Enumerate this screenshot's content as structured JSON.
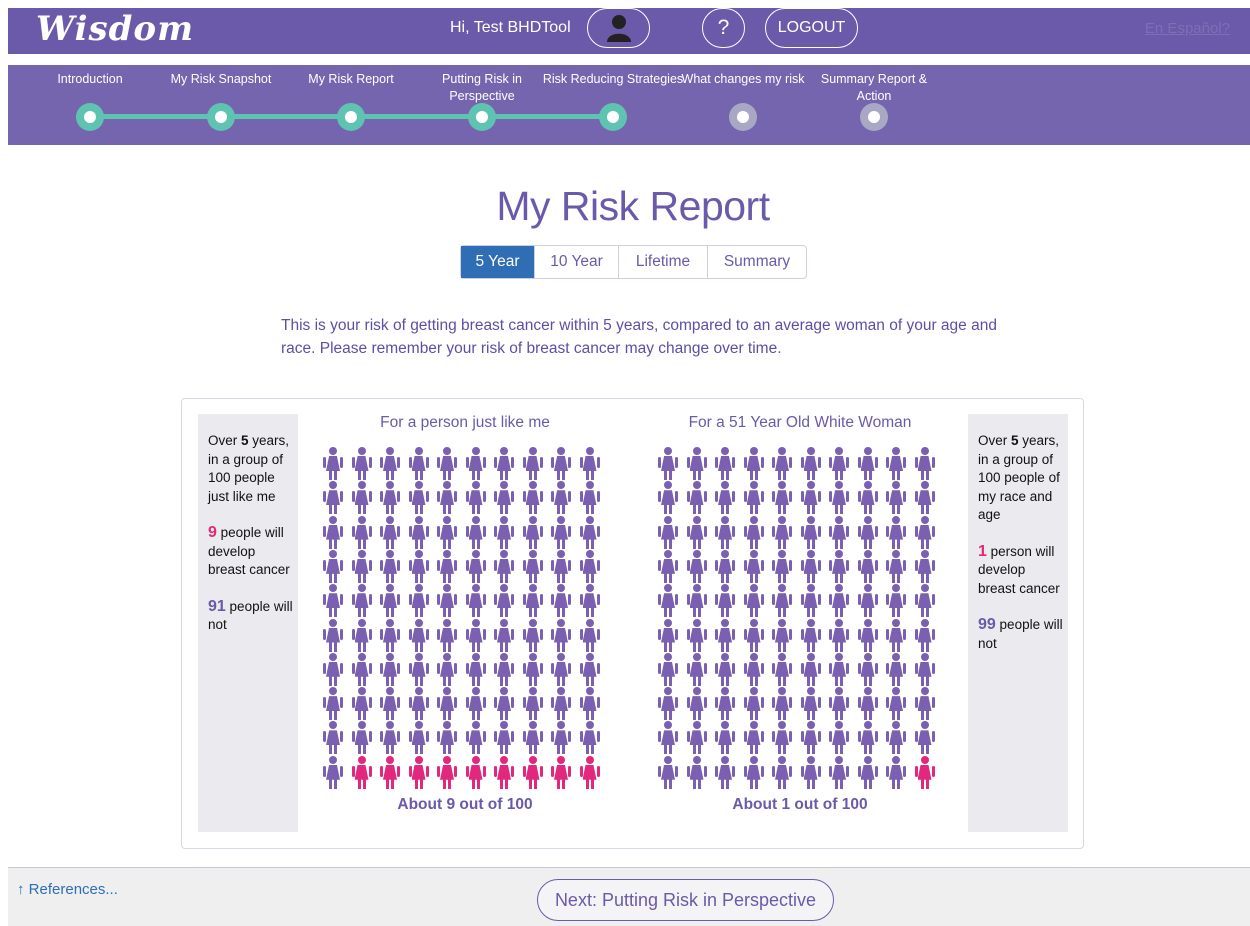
{
  "header": {
    "logo": "Wisdom",
    "greeting": "Hi, Test BHDTool",
    "help_label": "?",
    "logout_label": "LOGOUT",
    "espanol_label": "En Español?",
    "colors": {
      "header_bg": "#6a5aa9",
      "nav_bg": "#7565ae",
      "progress_done": "#5ec3b1",
      "progress_todo": "#a8a8c4"
    }
  },
  "progress": {
    "steps": [
      {
        "label": "Introduction",
        "status": "done"
      },
      {
        "label": "My Risk Snapshot",
        "status": "done"
      },
      {
        "label": "My Risk Report",
        "status": "done"
      },
      {
        "label": "Putting Risk in Perspective",
        "status": "done"
      },
      {
        "label": "Risk Reducing Strategies",
        "status": "done"
      },
      {
        "label": "What changes my risk",
        "status": "todo"
      },
      {
        "label": "Summary Report & Action",
        "status": "todo"
      }
    ]
  },
  "page": {
    "title": "My Risk Report",
    "tabs": [
      {
        "label": "5 Year",
        "active": true
      },
      {
        "label": "10 Year",
        "active": false
      },
      {
        "label": "Lifetime",
        "active": false
      },
      {
        "label": "Summary",
        "active": false
      }
    ],
    "intro": "This is your risk of getting breast cancer within 5 years, compared to an average woman of your age and race. Please remember your risk of breast cancer may change over time."
  },
  "risk_panel": {
    "left_side": {
      "line1_pre": "Over ",
      "line1_num": "5",
      "line1_post": " years, in a group of 100 people just like me",
      "affected_num": "9",
      "affected_text": " people will develop breast cancer",
      "unaffected_num": "91",
      "unaffected_text": " people will not"
    },
    "right_side": {
      "line1_pre": "Over ",
      "line1_num": "5",
      "line1_post": " years, in a group of 100 people of my race and age",
      "affected_num": "1",
      "affected_text": " person will develop breast cancer",
      "unaffected_num": "99",
      "unaffected_text": " people will not"
    },
    "charts": [
      {
        "heading": "For a person just like me",
        "affected": 9,
        "total": 100,
        "caption": "About 9 out of 100"
      },
      {
        "heading": "For a 51 Year Old White Woman",
        "affected": 1,
        "total": 100,
        "caption": "About 1 out of 100"
      }
    ],
    "colors": {
      "affected": "#e2287c",
      "unaffected": "#7b5fb0"
    }
  },
  "footer": {
    "references_label": "↑ References...",
    "next_label": "Next: Putting Risk in Perspective"
  }
}
